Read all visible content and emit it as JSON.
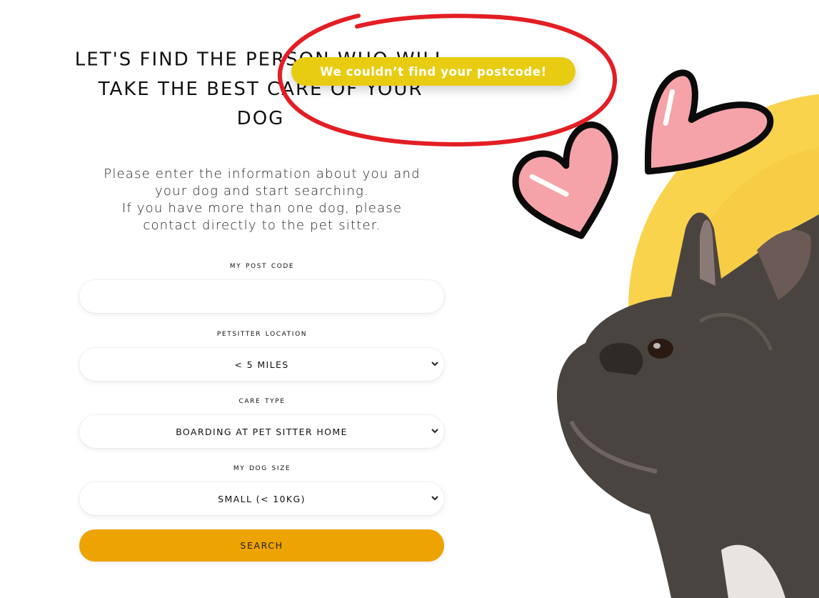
{
  "headline": "LET'S FIND THE PERSON WHO WILL TAKE THE BEST CARE OF YOUR DOG",
  "intro": {
    "line1": "Please enter the information about you and",
    "line2": "your dog and start searching.",
    "line3": "If you have more than one dog, please",
    "line4": "contact directly to the pet sitter."
  },
  "form": {
    "postcode_label": "MY POST CODE",
    "postcode_value": "",
    "location_label": "PETSITTER LOCATION",
    "location_value": "< 5 MILES",
    "care_label": "CARE TYPE",
    "care_value": "BOARDING AT PET SITTER HOME",
    "size_label": "MY DOG SIZE",
    "size_value": "SMALL (< 10KG)",
    "search_label": "SEARCH"
  },
  "toast": {
    "message": "We couldn’t find your postcode!"
  },
  "colors": {
    "accent": "#eda301",
    "toast": "#e8cc12",
    "annotation": "#e31e24",
    "sun": "#f9d34c",
    "heart": "#f5a3a8"
  },
  "icons": {
    "select_chevron": "chevron-down-icon",
    "heart": "heart-icon"
  }
}
